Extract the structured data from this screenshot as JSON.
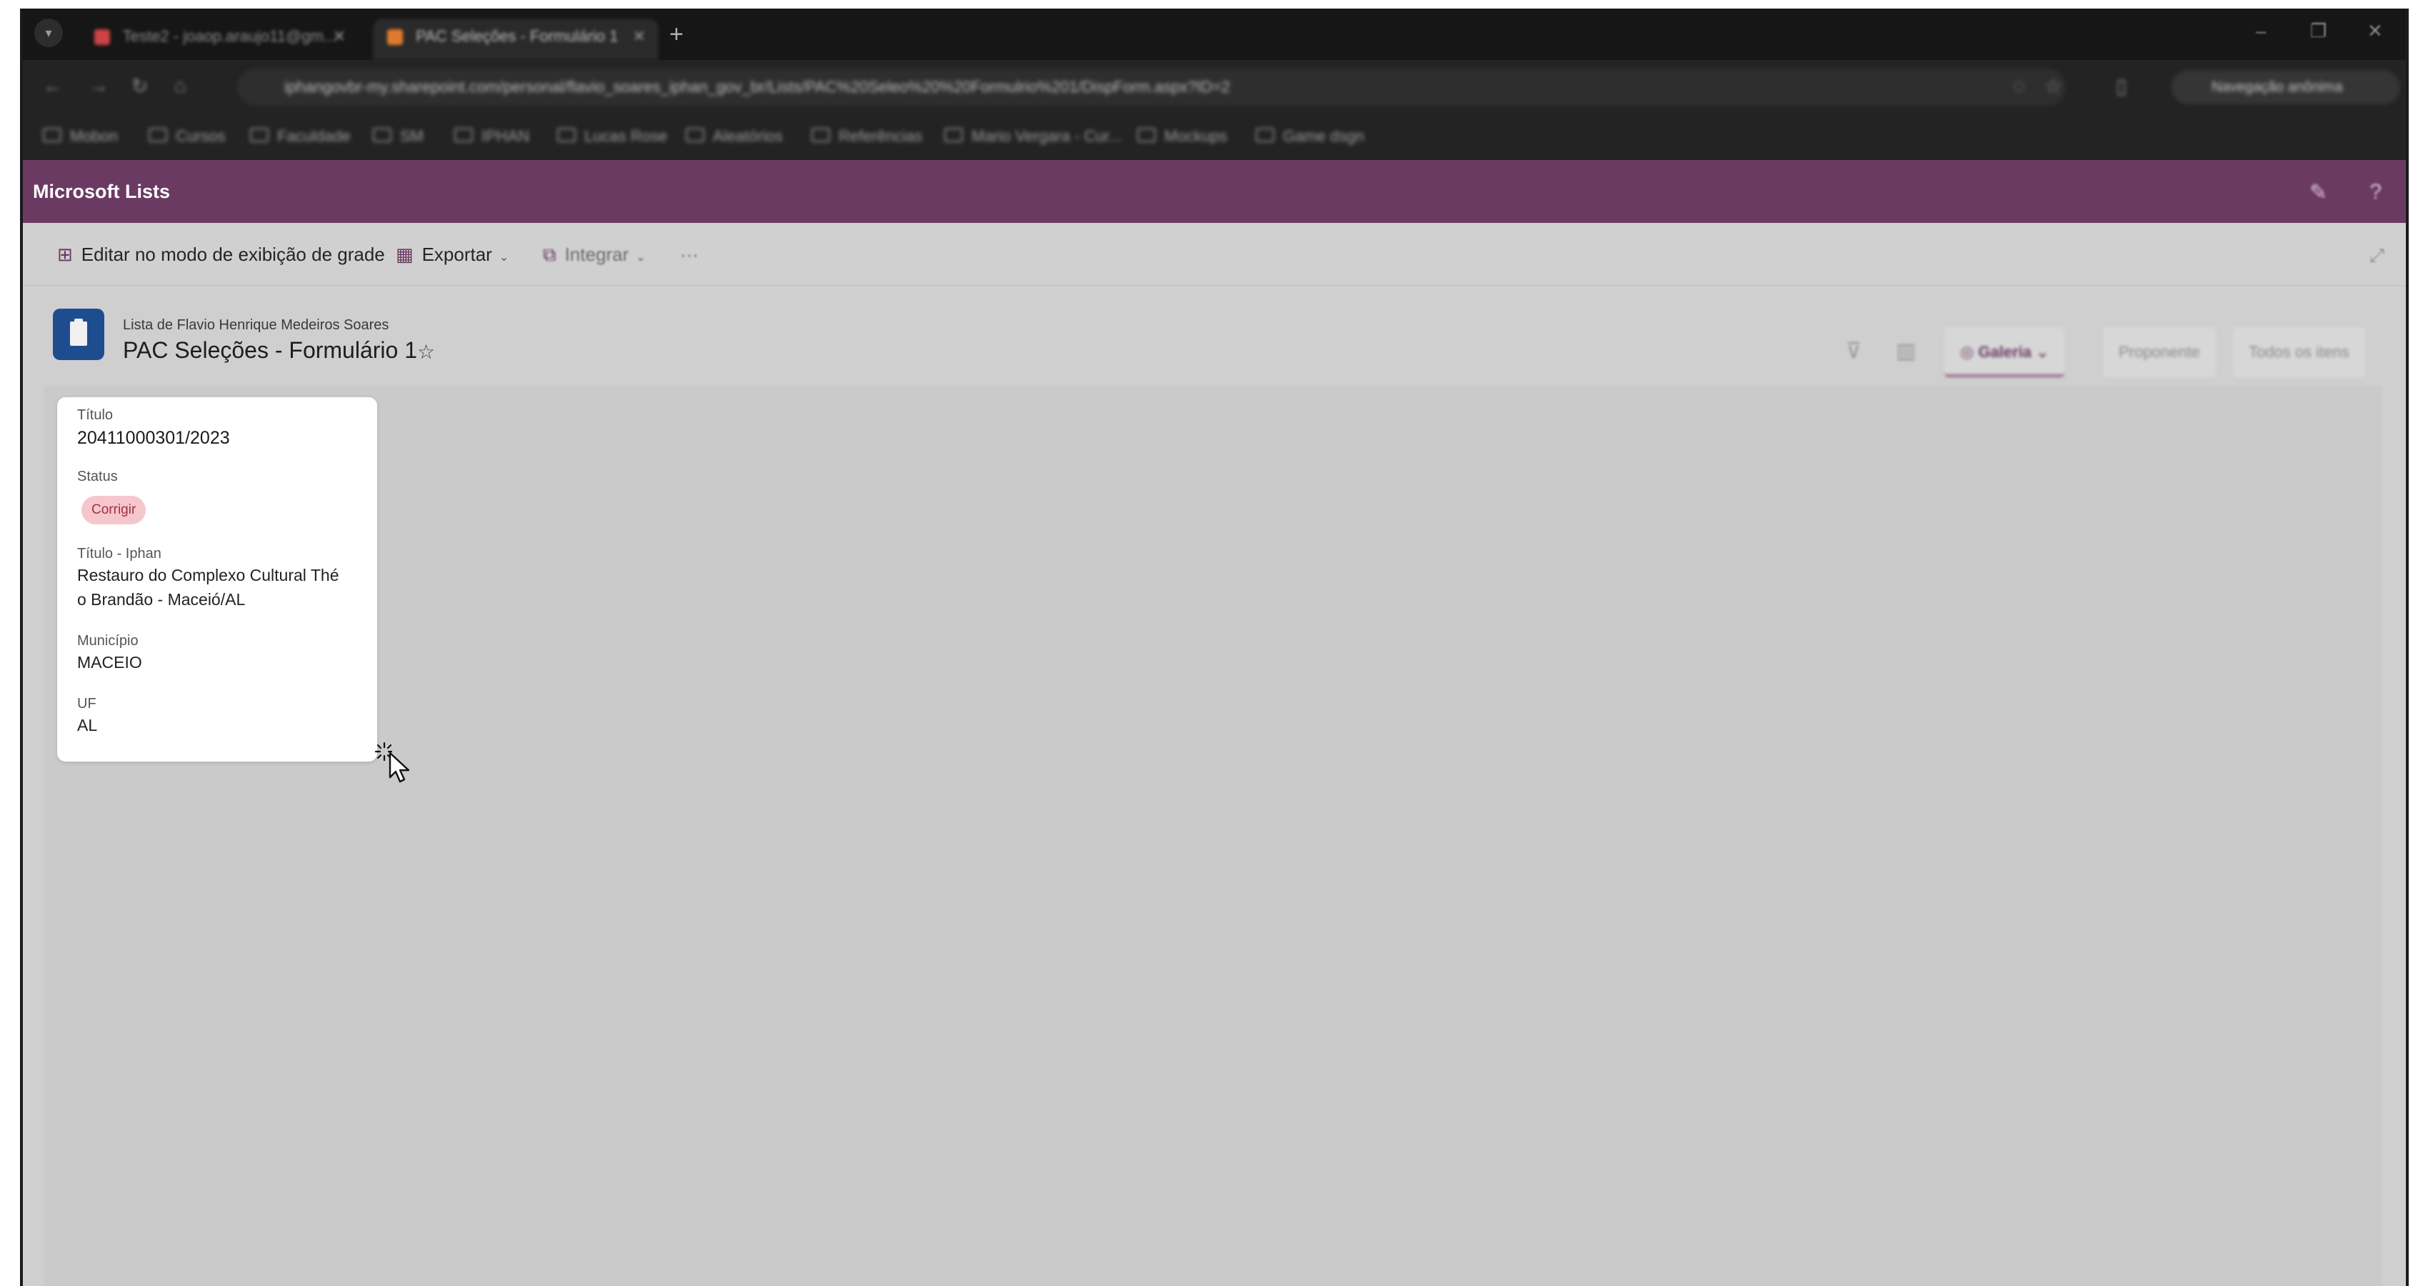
{
  "browser": {
    "tabs": [
      {
        "title": "Teste2 - joaop.araujo11@gm...",
        "active": false
      },
      {
        "title": "PAC Seleções - Formulário 1",
        "active": true
      }
    ],
    "url": "iphangovbr-my.sharepoint.com/personal/flavio_soares_iphan_gov_br/Lists/PAC%20Seleo%20%20Formulrio%201/DispForm.aspx?ID=2",
    "incognito_label": "Navegação anônima",
    "bookmarks": [
      "Mobon",
      "Cursos",
      "Faculdade",
      "SM",
      "IPHAN",
      "Lucas Rose",
      "Aleatórios",
      "Referências",
      "Mario Vergara - Cur...",
      "Mockups",
      "Game dsgn"
    ]
  },
  "app": {
    "title": "Microsoft Lists"
  },
  "commands": {
    "grid_edit": "Editar no modo de exibição de grade",
    "export": "Exportar",
    "integrate": "Integrar",
    "more": "···"
  },
  "list": {
    "owner": "Lista de Flavio Henrique Medeiros Soares",
    "title": "PAC Seleções - Formulário 1",
    "favorite_icon": "☆"
  },
  "views": {
    "filter_icon": "filter-icon",
    "group_icon": "group-icon",
    "current": "Galeria",
    "others": [
      "Proponente",
      "Todos os itens"
    ]
  },
  "card": {
    "titulo_label": "Título",
    "titulo_value": "20411000301/2023",
    "status_label": "Status",
    "status_value": "Corrigir",
    "titulo_iphan_label": "Título - Iphan",
    "titulo_iphan_line1": "Restauro do Complexo Cultural Thé",
    "titulo_iphan_line2": "o Brandão - Maceió/AL",
    "municipio_label": "Município",
    "municipio_value": "MACEIO",
    "uf_label": "UF",
    "uf_value": "AL"
  },
  "colors": {
    "suitebar": "#6b3a63",
    "list_icon": "#1e4d8f",
    "status_badge_bg": "#f6c6cd",
    "status_badge_text": "#a03241"
  }
}
